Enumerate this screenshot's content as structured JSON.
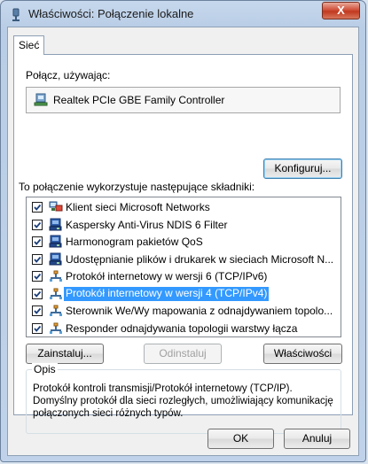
{
  "window": {
    "title": "Właściwości: Połączenie lokalne",
    "close_label": "X"
  },
  "tab": {
    "label": "Sieć"
  },
  "connect": {
    "label": "Połącz, używając:",
    "adapter_name": "Realtek PCIe GBE Family Controller",
    "configure_label": "Konfiguruj..."
  },
  "components": {
    "label": "To połączenie wykorzystuje następujące składniki:",
    "items": [
      {
        "label": "Klient sieci Microsoft Networks",
        "checked": true,
        "icon": "network-client-icon"
      },
      {
        "label": "Kaspersky Anti-Virus NDIS 6 Filter",
        "checked": true,
        "icon": "network-service-icon"
      },
      {
        "label": "Harmonogram pakietów QoS",
        "checked": true,
        "icon": "network-service-icon"
      },
      {
        "label": "Udostępnianie plików i drukarek w sieciach Microsoft N...",
        "checked": true,
        "icon": "network-service-icon"
      },
      {
        "label": "Protokół internetowy w wersji 6 (TCP/IPv6)",
        "checked": true,
        "icon": "protocol-icon"
      },
      {
        "label": "Protokół internetowy w wersji 4 (TCP/IPv4)",
        "checked": true,
        "icon": "protocol-icon",
        "selected": true
      },
      {
        "label": "Sterownik We/Wy mapowania z odnajdywaniem topolo...",
        "checked": true,
        "icon": "protocol-icon"
      },
      {
        "label": "Responder odnajdywania topologii warstwy łącza",
        "checked": true,
        "icon": "protocol-icon"
      }
    ]
  },
  "actions": {
    "install_label": "Zainstaluj...",
    "uninstall_label": "Odinstaluj",
    "properties_label": "Właściwości"
  },
  "description": {
    "legend": "Opis",
    "text": "Protokół kontroli transmisji/Protokół internetowy (TCP/IP). Domyślny protokół dla sieci rozległych, umożliwiający komunikację połączonych sieci różnych typów."
  },
  "footer": {
    "ok_label": "OK",
    "cancel_label": "Anuluj"
  },
  "colors": {
    "selection": "#3399ff",
    "title_bar": "#c6d8ec",
    "close_button": "#c0391f"
  }
}
